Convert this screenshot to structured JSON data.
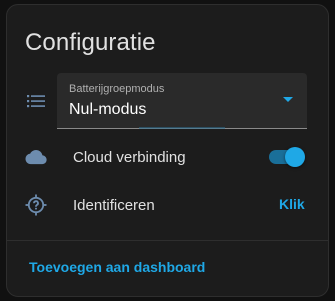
{
  "card": {
    "title": "Configuratie"
  },
  "battery_mode": {
    "icon": "list-icon",
    "label": "Batterijgroepmodus",
    "value": "Nul-modus"
  },
  "cloud": {
    "icon": "cloud-icon",
    "label": "Cloud verbinding",
    "enabled": true
  },
  "identify": {
    "icon": "crosshairs-question-icon",
    "label": "Identificeren",
    "action": "Klik"
  },
  "footer": {
    "link": "Toevoegen aan dashboard"
  },
  "colors": {
    "accent": "#1fa8e6",
    "card_background": "#1c1c1c",
    "page_background": "#111111",
    "icon": "#6d8cae"
  }
}
